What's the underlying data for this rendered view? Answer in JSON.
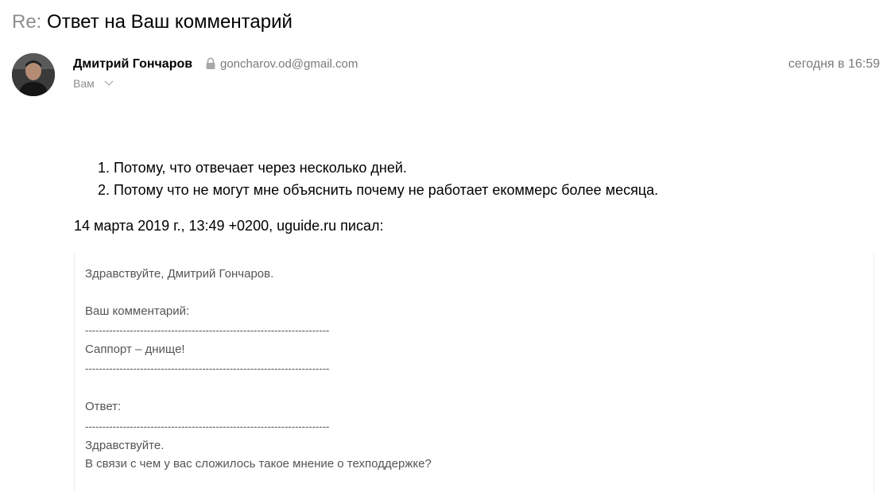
{
  "subject": {
    "prefix": "Re:",
    "title": "Ответ на Ваш комментарий"
  },
  "sender": {
    "name": "Дмитрий Гончаров",
    "email": "goncharov.od@gmail.com",
    "lock_icon": "lock-icon"
  },
  "recipient": {
    "label": "Вам",
    "chevron_icon": "chevron-down-icon"
  },
  "date": "сегодня в 16:59",
  "body": {
    "reply_items": [
      "Потому, что отвечает через несколько дней.",
      "Потому что не могут мне объяснить почему не работает екоммерс более месяца."
    ],
    "quote_header": "14 марта 2019 г., 13:49 +0200, uguide.ru писал:"
  },
  "quote": {
    "greeting": "Здравствуйте, Дмитрий Гончаров.",
    "comment_label": "Ваш комментарий:",
    "separator": "-----------------------------------------------------------------------",
    "comment_text": "Саппорт – днище!",
    "answer_label": "Ответ:",
    "answer_greeting": "Здравствуйте.",
    "answer_text": "В связи с чем у вас сложилось такое мнение о техподдержке?"
  }
}
